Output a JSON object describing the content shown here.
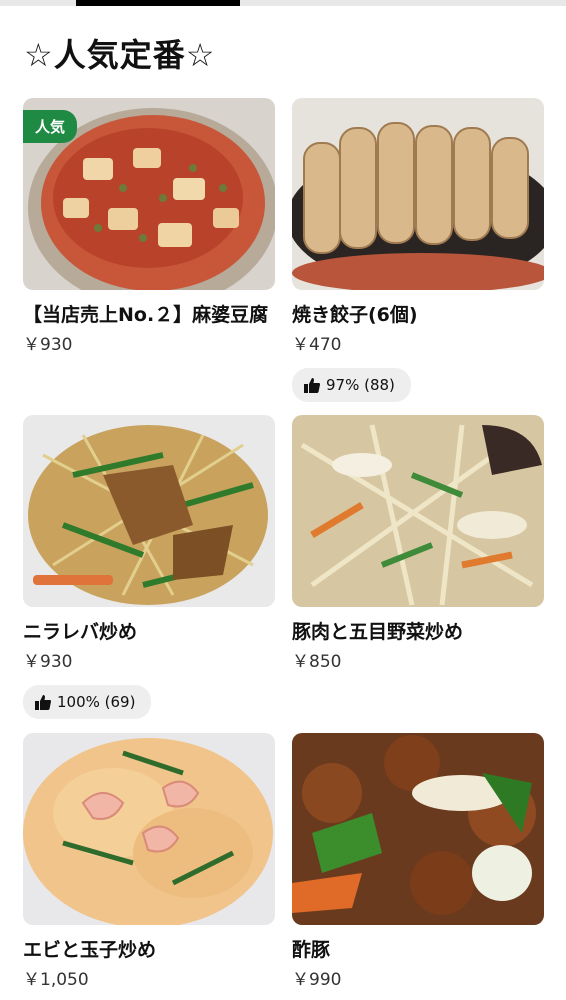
{
  "header": {
    "title": "☆人気定番☆"
  },
  "items": [
    {
      "name": "【当店売上No.２】麻婆豆腐",
      "price": "￥930",
      "badge": "人気",
      "rating": ""
    },
    {
      "name": "焼き餃子(6個)",
      "price": "￥470",
      "badge": "",
      "rating": "97% (88)"
    },
    {
      "name": "ニラレバ炒め",
      "price": "￥930",
      "badge": "",
      "rating": "100% (69)"
    },
    {
      "name": "豚肉と五目野菜炒め",
      "price": "￥850",
      "badge": "",
      "rating": ""
    },
    {
      "name": "エビと玉子炒め",
      "price": "￥1,050",
      "badge": "",
      "rating": ""
    },
    {
      "name": "酢豚",
      "price": "￥990",
      "badge": "",
      "rating": ""
    }
  ],
  "colors": {
    "badge_green": "#1f8a43",
    "rating_bg": "#eeeeee",
    "tab_active": "#000000"
  }
}
